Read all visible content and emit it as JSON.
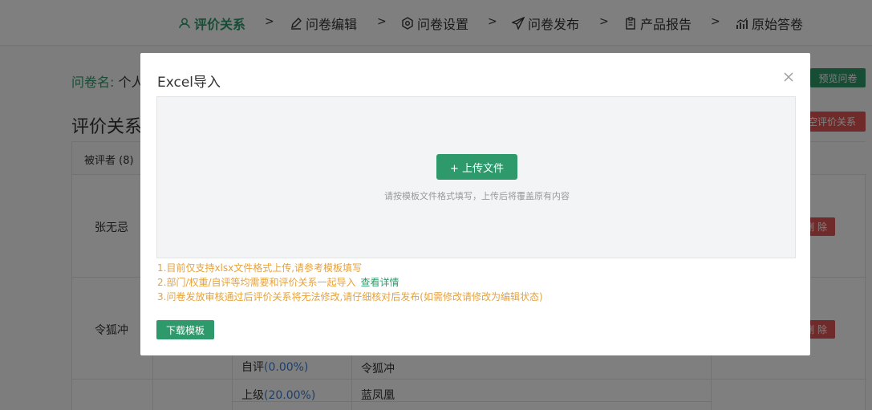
{
  "nav": {
    "steps": [
      {
        "label": "评价关系",
        "icon": "users-icon"
      },
      {
        "label": "问卷编辑",
        "icon": "edit-icon"
      },
      {
        "label": "问卷设置",
        "icon": "settings-icon"
      },
      {
        "label": "问卷发布",
        "icon": "send-icon"
      },
      {
        "label": "产品报告",
        "icon": "clipboard-icon"
      },
      {
        "label": "原始答卷",
        "icon": "chart-icon"
      }
    ],
    "separator": ">"
  },
  "page": {
    "survey_name_label": "问卷名:",
    "survey_name_value": "个人",
    "preview_button": "预览问卷",
    "section_title": "评价关系",
    "clear_button": "空评价关系",
    "table": {
      "header_first": "被评者 (8)",
      "rows": [
        {
          "name": "张无忌",
          "delete": "删 除"
        },
        {
          "name": "令狐冲",
          "delete": "删 除"
        }
      ],
      "sub_rows": [
        {
          "type": "自评",
          "pct": "(0.00%)",
          "evaluator": "令狐冲"
        },
        {
          "type": "上级",
          "pct": "(20.00%)",
          "evaluator": "蓝凤凰"
        }
      ]
    }
  },
  "modal": {
    "title": "Excel导入",
    "upload_button": "+ 上传文件",
    "upload_hint": "请按模板文件格式填写，上传后将覆盖原有内容",
    "notes": [
      "1.目前仅支持xlsx文件格式上传,请参考模板填写",
      "2.部门/权重/自评等均需要和评价关系一起导入",
      "3.问卷发放审核通过后评价关系将无法修改,请仔细核对后发布(如需修改请修改为编辑状态)"
    ],
    "details_link": "查看详情",
    "download_button": "下载模板"
  },
  "colors": {
    "primary": "#2e9a6b",
    "danger": "#e05555",
    "warning": "#e6a23c",
    "link_blue": "#3b7fd6"
  }
}
